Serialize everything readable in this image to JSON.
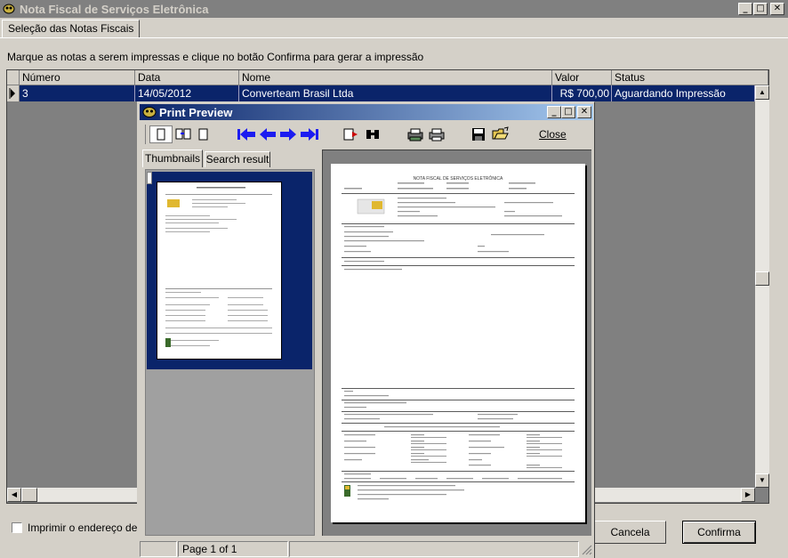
{
  "app": {
    "title": "Nota Fiscal de Serviços Eletrônica",
    "tab_label": "Seleção das Notas Fiscais",
    "instruction": "Marque as notas a serem impressas e clique no botão Confirma para gerar a impressão"
  },
  "grid": {
    "columns": [
      "Número",
      "Data",
      "Nome",
      "Valor",
      "Status"
    ],
    "rows": [
      {
        "numero": "3",
        "data": "14/05/2012",
        "nome": "Converteam Brasil Ltda",
        "valor": "R$ 700,00",
        "status": "Aguardando Impressão"
      }
    ]
  },
  "footer": {
    "checkbox_label": "Imprimir o endereço de c",
    "cancel_label": "Cancela",
    "confirm_label": "Confirma"
  },
  "print_preview": {
    "title": "Print Preview",
    "close_label": "Close",
    "tabs": [
      "Thumbnails",
      "Search result"
    ],
    "page_status": "Page 1 of 1",
    "page_title": "NOTA FISCAL DE SERVIÇOS ELETRÔNICA"
  },
  "colors": {
    "selection": "#0a246a",
    "title_active": "#0a246a",
    "title_inactive": "#808080",
    "nav_arrows": "#1c1cf0"
  }
}
